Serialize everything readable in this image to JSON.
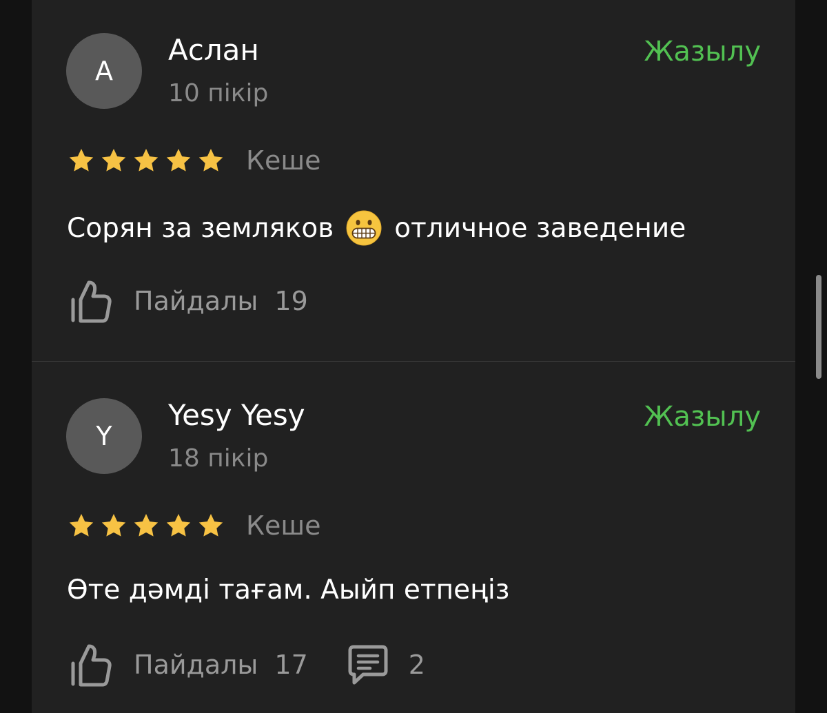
{
  "reviews": [
    {
      "avatar_letter": "A",
      "name": "Аслан",
      "review_count": "10 пікір",
      "subscribe_label": "Жазылу",
      "rating": 5,
      "date": "Кеше",
      "text_before": "Сорян за земляков",
      "emoji": "grimacing-face-emoji",
      "text_after": "отличное заведение",
      "helpful_label": "Пайдалы",
      "helpful_count": "19"
    },
    {
      "avatar_letter": "Y",
      "name": "Yesy Yesy",
      "review_count": "18 пікір",
      "subscribe_label": "Жазылу",
      "rating": 5,
      "date": "Кеше",
      "text": "Өте дәмді тағам. Аыйп етпеңіз",
      "helpful_label": "Пайдалы",
      "helpful_count": "17",
      "comments_count": "2"
    }
  ],
  "colors": {
    "background": "#212121",
    "accent": "#52c152",
    "star": "#f7c244",
    "muted_text": "#8a8a8a"
  },
  "icons": {
    "helpful": "thumbs-up-icon",
    "comments": "comment-icon",
    "star": "star-icon"
  }
}
